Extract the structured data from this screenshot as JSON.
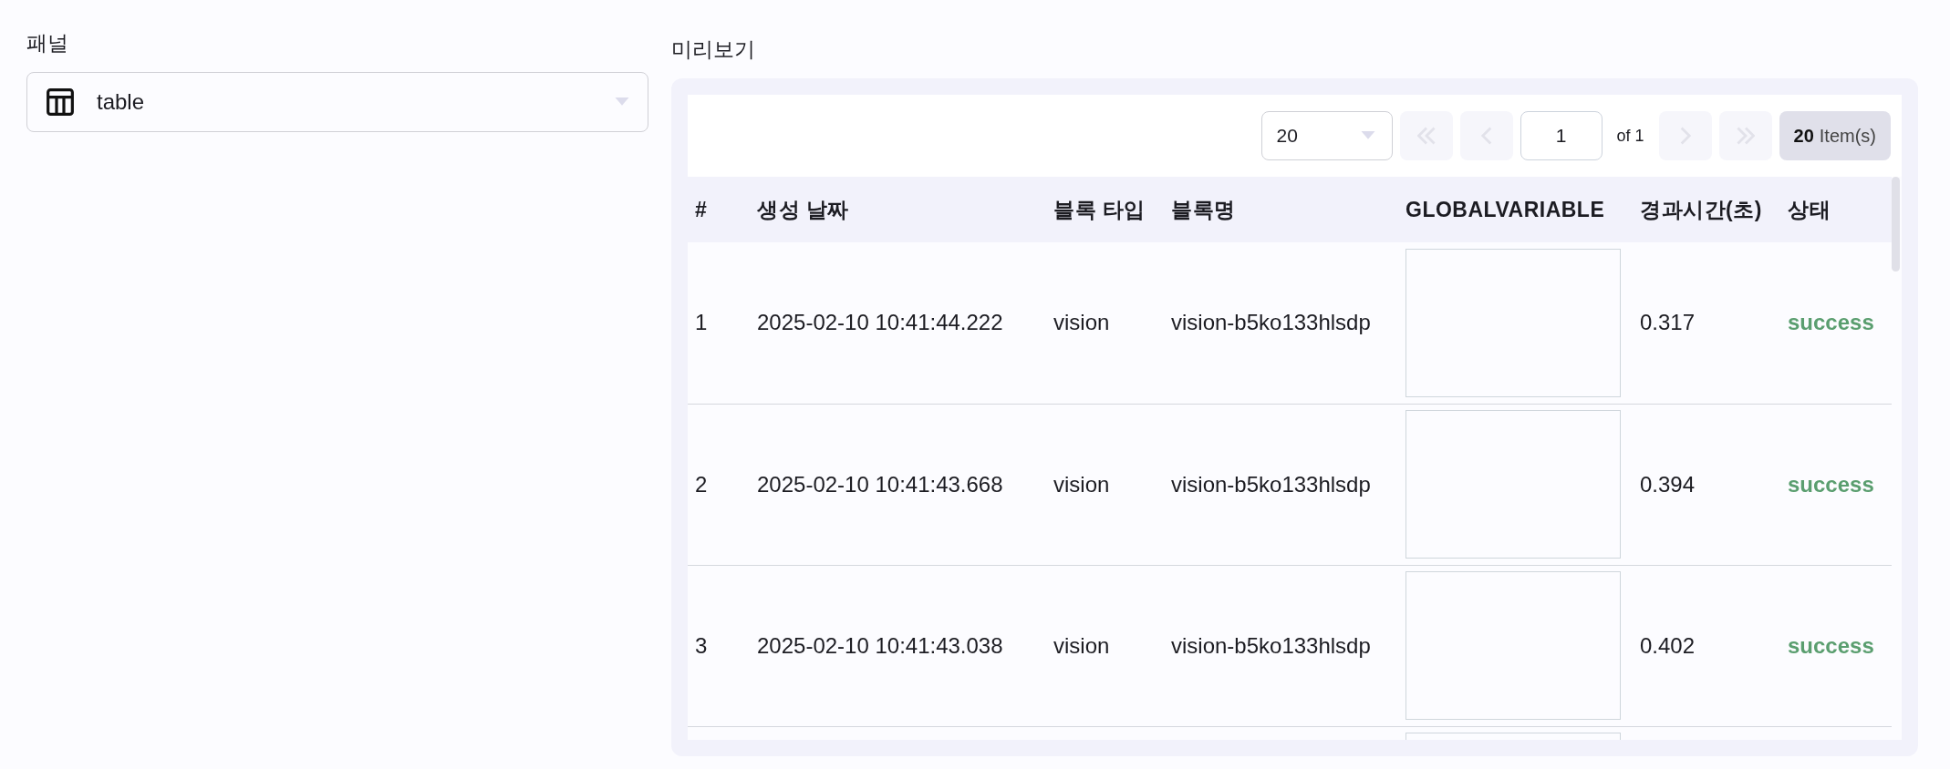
{
  "panel": {
    "label": "패널",
    "select": {
      "value": "table"
    }
  },
  "preview": {
    "label": "미리보기",
    "pager": {
      "page_size": "20",
      "page": "1",
      "of_text": "of 1",
      "total": "20",
      "total_unit": "Item(s)",
      "buttons": [
        {
          "kind": "first",
          "disabled": true
        },
        {
          "kind": "prev",
          "disabled": true
        },
        {
          "kind": "page"
        },
        {
          "kind": "next",
          "disabled": true
        },
        {
          "kind": "last",
          "disabled": true
        }
      ]
    },
    "table": {
      "columns": [
        "#",
        "생성 날짜",
        "블록 타입",
        "블록명",
        "GLOBALVARIABLE",
        "경과시간(초)",
        "상태"
      ],
      "rows": [
        {
          "index": "1",
          "created": "2025-02-10 10:41:44.222",
          "block_type": "vision",
          "block_name": "vision-b5ko133hlsdp",
          "elapsed": "0.317",
          "status": "success",
          "color": "#5a9e6f"
        },
        {
          "index": "2",
          "created": "2025-02-10 10:41:43.668",
          "block_type": "vision",
          "block_name": "vision-b5ko133hlsdp",
          "elapsed": "0.394",
          "status": "success",
          "color": "#5a9e6f"
        },
        {
          "index": "3",
          "created": "2025-02-10 10:41:43.038",
          "block_type": "vision",
          "block_name": "vision-b5ko133hlsdp",
          "elapsed": "0.402",
          "status": "success",
          "color": "#5a9e6f"
        }
      ]
    }
  }
}
